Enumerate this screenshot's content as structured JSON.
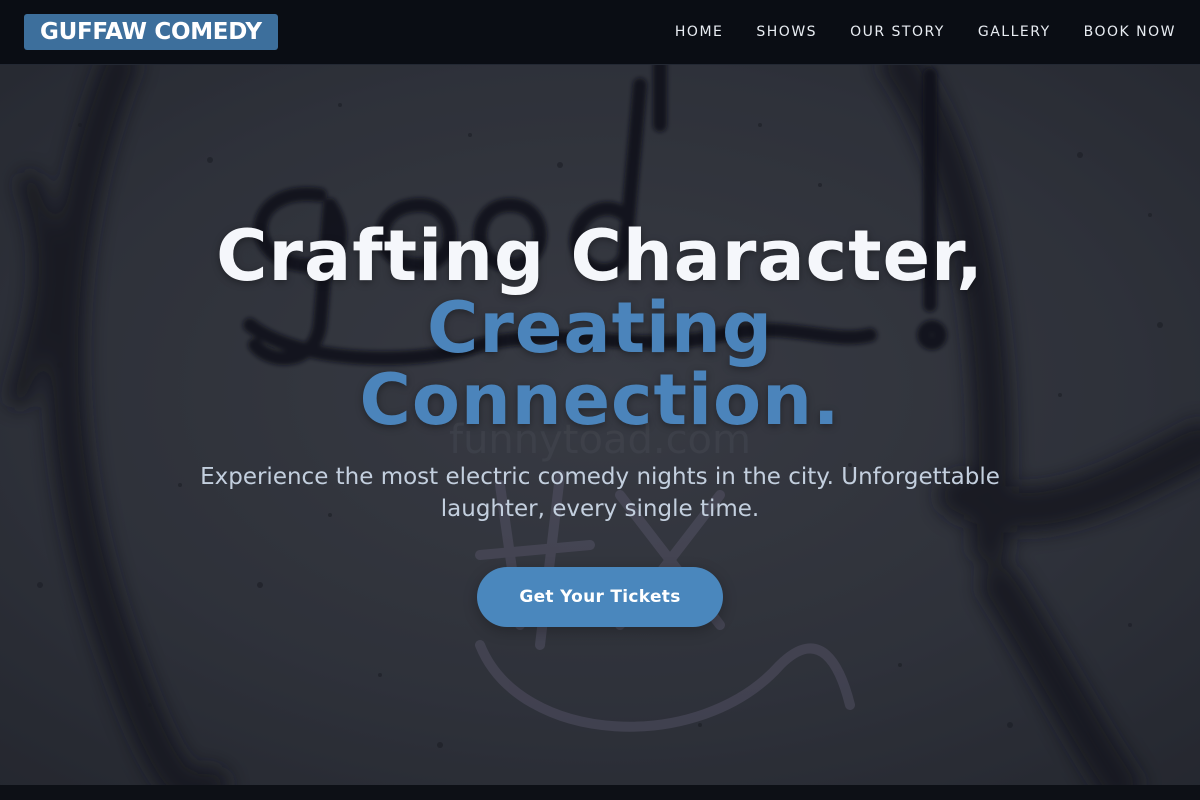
{
  "header": {
    "logo": "GUFFAW COMEDY",
    "nav": [
      {
        "label": "HOME"
      },
      {
        "label": "SHOWS"
      },
      {
        "label": "OUR STORY"
      },
      {
        "label": "GALLERY"
      },
      {
        "label": "BOOK NOW"
      }
    ]
  },
  "hero": {
    "headline_line1": "Crafting Character,",
    "headline_line2": "Creating",
    "headline_line3": "Connection.",
    "subtitle": "Experience the most electric comedy nights in the city. Unforgettable laughter, every single time.",
    "cta_label": "Get Your Tickets",
    "background_image": "graffiti-wall"
  },
  "colors": {
    "accent": "#4a87bd",
    "logo_bg": "#3d6f9c",
    "header_bg": "#0a0d14",
    "headline_white": "#f5f7fb",
    "subtitle": "#c3cfde"
  }
}
